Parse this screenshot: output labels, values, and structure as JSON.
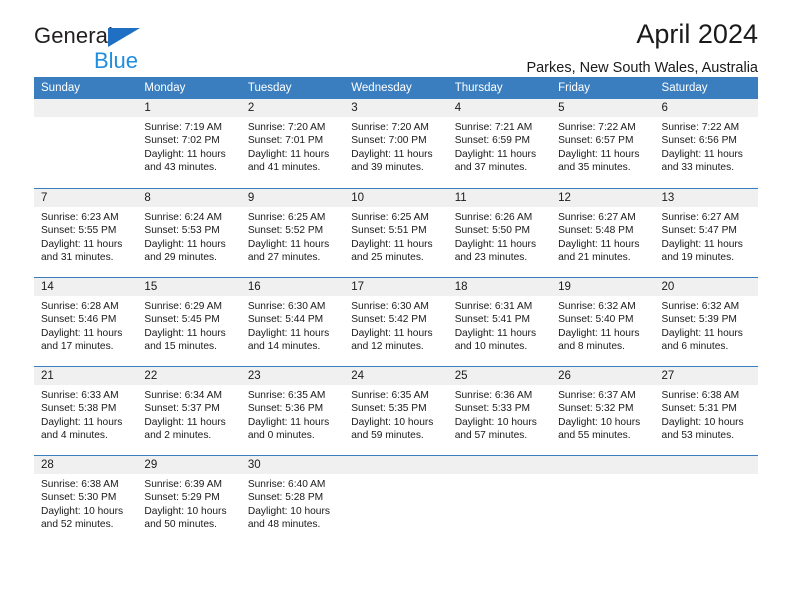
{
  "brand": {
    "name_top": "General",
    "name_bottom": "Blue",
    "accent_color": "#1f8ee0",
    "triangle_color": "#1f6fc4"
  },
  "header": {
    "title": "April 2024",
    "subtitle": "Parkes, New South Wales, Australia"
  },
  "calendar": {
    "header_color": "#3a7ebf",
    "day_band_color": "#f0f0f0",
    "weekdays": [
      "Sunday",
      "Monday",
      "Tuesday",
      "Wednesday",
      "Thursday",
      "Friday",
      "Saturday"
    ],
    "weeks": [
      [
        {
          "day": "",
          "sunrise": "",
          "sunset": "",
          "daylight_line1": "",
          "daylight_line2": ""
        },
        {
          "day": "1",
          "sunrise": "Sunrise: 7:19 AM",
          "sunset": "Sunset: 7:02 PM",
          "daylight_line1": "Daylight: 11 hours",
          "daylight_line2": "and 43 minutes."
        },
        {
          "day": "2",
          "sunrise": "Sunrise: 7:20 AM",
          "sunset": "Sunset: 7:01 PM",
          "daylight_line1": "Daylight: 11 hours",
          "daylight_line2": "and 41 minutes."
        },
        {
          "day": "3",
          "sunrise": "Sunrise: 7:20 AM",
          "sunset": "Sunset: 7:00 PM",
          "daylight_line1": "Daylight: 11 hours",
          "daylight_line2": "and 39 minutes."
        },
        {
          "day": "4",
          "sunrise": "Sunrise: 7:21 AM",
          "sunset": "Sunset: 6:59 PM",
          "daylight_line1": "Daylight: 11 hours",
          "daylight_line2": "and 37 minutes."
        },
        {
          "day": "5",
          "sunrise": "Sunrise: 7:22 AM",
          "sunset": "Sunset: 6:57 PM",
          "daylight_line1": "Daylight: 11 hours",
          "daylight_line2": "and 35 minutes."
        },
        {
          "day": "6",
          "sunrise": "Sunrise: 7:22 AM",
          "sunset": "Sunset: 6:56 PM",
          "daylight_line1": "Daylight: 11 hours",
          "daylight_line2": "and 33 minutes."
        }
      ],
      [
        {
          "day": "7",
          "sunrise": "Sunrise: 6:23 AM",
          "sunset": "Sunset: 5:55 PM",
          "daylight_line1": "Daylight: 11 hours",
          "daylight_line2": "and 31 minutes."
        },
        {
          "day": "8",
          "sunrise": "Sunrise: 6:24 AM",
          "sunset": "Sunset: 5:53 PM",
          "daylight_line1": "Daylight: 11 hours",
          "daylight_line2": "and 29 minutes."
        },
        {
          "day": "9",
          "sunrise": "Sunrise: 6:25 AM",
          "sunset": "Sunset: 5:52 PM",
          "daylight_line1": "Daylight: 11 hours",
          "daylight_line2": "and 27 minutes."
        },
        {
          "day": "10",
          "sunrise": "Sunrise: 6:25 AM",
          "sunset": "Sunset: 5:51 PM",
          "daylight_line1": "Daylight: 11 hours",
          "daylight_line2": "and 25 minutes."
        },
        {
          "day": "11",
          "sunrise": "Sunrise: 6:26 AM",
          "sunset": "Sunset: 5:50 PM",
          "daylight_line1": "Daylight: 11 hours",
          "daylight_line2": "and 23 minutes."
        },
        {
          "day": "12",
          "sunrise": "Sunrise: 6:27 AM",
          "sunset": "Sunset: 5:48 PM",
          "daylight_line1": "Daylight: 11 hours",
          "daylight_line2": "and 21 minutes."
        },
        {
          "day": "13",
          "sunrise": "Sunrise: 6:27 AM",
          "sunset": "Sunset: 5:47 PM",
          "daylight_line1": "Daylight: 11 hours",
          "daylight_line2": "and 19 minutes."
        }
      ],
      [
        {
          "day": "14",
          "sunrise": "Sunrise: 6:28 AM",
          "sunset": "Sunset: 5:46 PM",
          "daylight_line1": "Daylight: 11 hours",
          "daylight_line2": "and 17 minutes."
        },
        {
          "day": "15",
          "sunrise": "Sunrise: 6:29 AM",
          "sunset": "Sunset: 5:45 PM",
          "daylight_line1": "Daylight: 11 hours",
          "daylight_line2": "and 15 minutes."
        },
        {
          "day": "16",
          "sunrise": "Sunrise: 6:30 AM",
          "sunset": "Sunset: 5:44 PM",
          "daylight_line1": "Daylight: 11 hours",
          "daylight_line2": "and 14 minutes."
        },
        {
          "day": "17",
          "sunrise": "Sunrise: 6:30 AM",
          "sunset": "Sunset: 5:42 PM",
          "daylight_line1": "Daylight: 11 hours",
          "daylight_line2": "and 12 minutes."
        },
        {
          "day": "18",
          "sunrise": "Sunrise: 6:31 AM",
          "sunset": "Sunset: 5:41 PM",
          "daylight_line1": "Daylight: 11 hours",
          "daylight_line2": "and 10 minutes."
        },
        {
          "day": "19",
          "sunrise": "Sunrise: 6:32 AM",
          "sunset": "Sunset: 5:40 PM",
          "daylight_line1": "Daylight: 11 hours",
          "daylight_line2": "and 8 minutes."
        },
        {
          "day": "20",
          "sunrise": "Sunrise: 6:32 AM",
          "sunset": "Sunset: 5:39 PM",
          "daylight_line1": "Daylight: 11 hours",
          "daylight_line2": "and 6 minutes."
        }
      ],
      [
        {
          "day": "21",
          "sunrise": "Sunrise: 6:33 AM",
          "sunset": "Sunset: 5:38 PM",
          "daylight_line1": "Daylight: 11 hours",
          "daylight_line2": "and 4 minutes."
        },
        {
          "day": "22",
          "sunrise": "Sunrise: 6:34 AM",
          "sunset": "Sunset: 5:37 PM",
          "daylight_line1": "Daylight: 11 hours",
          "daylight_line2": "and 2 minutes."
        },
        {
          "day": "23",
          "sunrise": "Sunrise: 6:35 AM",
          "sunset": "Sunset: 5:36 PM",
          "daylight_line1": "Daylight: 11 hours",
          "daylight_line2": "and 0 minutes."
        },
        {
          "day": "24",
          "sunrise": "Sunrise: 6:35 AM",
          "sunset": "Sunset: 5:35 PM",
          "daylight_line1": "Daylight: 10 hours",
          "daylight_line2": "and 59 minutes."
        },
        {
          "day": "25",
          "sunrise": "Sunrise: 6:36 AM",
          "sunset": "Sunset: 5:33 PM",
          "daylight_line1": "Daylight: 10 hours",
          "daylight_line2": "and 57 minutes."
        },
        {
          "day": "26",
          "sunrise": "Sunrise: 6:37 AM",
          "sunset": "Sunset: 5:32 PM",
          "daylight_line1": "Daylight: 10 hours",
          "daylight_line2": "and 55 minutes."
        },
        {
          "day": "27",
          "sunrise": "Sunrise: 6:38 AM",
          "sunset": "Sunset: 5:31 PM",
          "daylight_line1": "Daylight: 10 hours",
          "daylight_line2": "and 53 minutes."
        }
      ],
      [
        {
          "day": "28",
          "sunrise": "Sunrise: 6:38 AM",
          "sunset": "Sunset: 5:30 PM",
          "daylight_line1": "Daylight: 10 hours",
          "daylight_line2": "and 52 minutes."
        },
        {
          "day": "29",
          "sunrise": "Sunrise: 6:39 AM",
          "sunset": "Sunset: 5:29 PM",
          "daylight_line1": "Daylight: 10 hours",
          "daylight_line2": "and 50 minutes."
        },
        {
          "day": "30",
          "sunrise": "Sunrise: 6:40 AM",
          "sunset": "Sunset: 5:28 PM",
          "daylight_line1": "Daylight: 10 hours",
          "daylight_line2": "and 48 minutes."
        },
        {
          "day": "",
          "sunrise": "",
          "sunset": "",
          "daylight_line1": "",
          "daylight_line2": ""
        },
        {
          "day": "",
          "sunrise": "",
          "sunset": "",
          "daylight_line1": "",
          "daylight_line2": ""
        },
        {
          "day": "",
          "sunrise": "",
          "sunset": "",
          "daylight_line1": "",
          "daylight_line2": ""
        },
        {
          "day": "",
          "sunrise": "",
          "sunset": "",
          "daylight_line1": "",
          "daylight_line2": ""
        }
      ]
    ]
  }
}
